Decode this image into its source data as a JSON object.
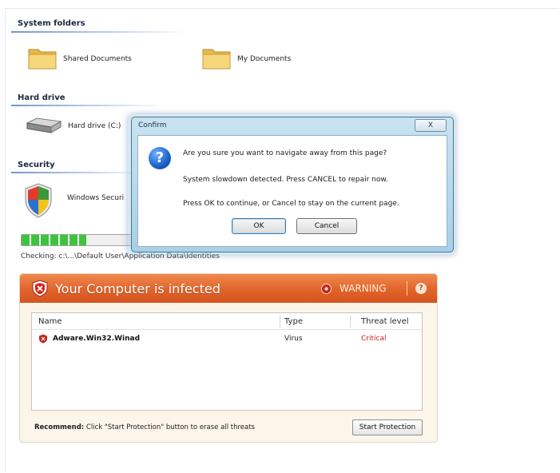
{
  "sections": {
    "system_folders": "System folders",
    "hard_drive": "Hard drive",
    "security": "Security"
  },
  "items": {
    "shared_documents": "Shared Documents",
    "my_documents": "My Documents",
    "hard_drive_label": "Hard drive (C:)",
    "windows_security": "Windows Securi"
  },
  "scan": {
    "progress_percent": 58,
    "checking_text": "Checking: c:\\...\\Default User\\Application Data\\Identities"
  },
  "infected_panel": {
    "title": "Your Computer is infected",
    "warning_label": "WARNING",
    "help_label": "?",
    "columns": {
      "name": "Name",
      "type": "Type",
      "threat_level": "Threat level"
    },
    "threats": [
      {
        "name": "Adware.Win32.Winad",
        "type": "Virus",
        "level": "Critical"
      }
    ],
    "recommend_label": "Recommend:",
    "recommend_text": "Click \"Start Protection\" button to erase all threats",
    "start_button": "Start Protection"
  },
  "dialog": {
    "title": "Confirm",
    "close_label": "X",
    "line1": "Are you sure you want to navigate away from this page?",
    "line2": "System slowdown detected. Press CANCEL to repair now.",
    "line3": "Press OK to continue, or Cancel to stay on the current page.",
    "ok_button": "OK",
    "cancel_button": "Cancel"
  },
  "colors": {
    "panel_header": "#e0642a",
    "critical": "#d11a1a",
    "dialog_frame": "#a8d0e6",
    "progress": "#3cc43c"
  }
}
